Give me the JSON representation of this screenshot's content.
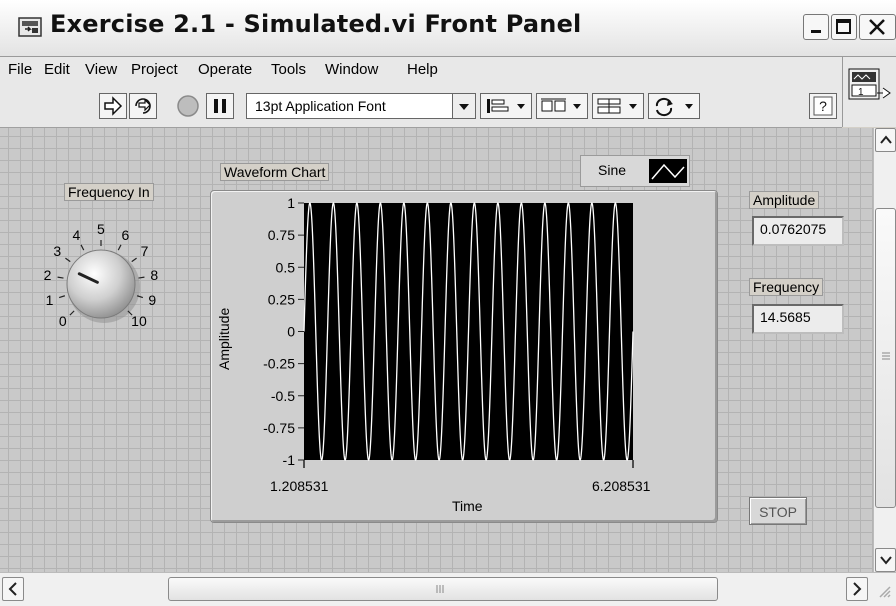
{
  "window": {
    "title": "Exercise 2.1 - Simulated.vi Front Panel",
    "buttons": [
      "minimize",
      "maximize",
      "close"
    ]
  },
  "menubar": {
    "items": [
      {
        "label": "File"
      },
      {
        "label": "Edit"
      },
      {
        "label": "View"
      },
      {
        "label": "Project"
      },
      {
        "label": "Operate"
      },
      {
        "label": "Tools"
      },
      {
        "label": "Window"
      },
      {
        "label": "Help"
      }
    ]
  },
  "toolbar": {
    "font": "13pt Application Font",
    "icons": [
      "run-arrow-icon",
      "run-continuously-icon",
      "abort-icon",
      "pause-icon",
      "align-objects-icon",
      "distribute-objects-icon",
      "resize-objects-icon",
      "reorder-icon",
      "help-icon"
    ],
    "vi_icon_number": "1"
  },
  "knob": {
    "label": "Frequency In",
    "scale": [
      "0",
      "1",
      "2",
      "3",
      "4",
      "5",
      "6",
      "7",
      "8",
      "9",
      "10"
    ],
    "value": 2.6
  },
  "chart": {
    "label": "Waveform Chart",
    "legend": "Sine",
    "ylabel": "Amplitude",
    "xlabel": "Time",
    "yticks": [
      "1",
      "0.75",
      "0.5",
      "0.25",
      "0",
      "-0.25",
      "-0.5",
      "-0.75",
      "-1"
    ],
    "xmin": "1.208531",
    "xmax": "6.208531"
  },
  "chart_data": {
    "type": "line",
    "x": [
      1.208531,
      6.208531
    ],
    "ylim": [
      -1,
      1
    ],
    "xlabel": "Time",
    "ylabel": "Amplitude",
    "series": [
      {
        "name": "Sine",
        "cycles": 14,
        "amplitude": 1,
        "color": "#ffffff"
      }
    ],
    "background": "#000000",
    "grid": false
  },
  "amplitude": {
    "label": "Amplitude",
    "value": "0.0762075"
  },
  "frequency": {
    "label": "Frequency",
    "value": "14.5685"
  },
  "stop": {
    "label": "STOP"
  }
}
